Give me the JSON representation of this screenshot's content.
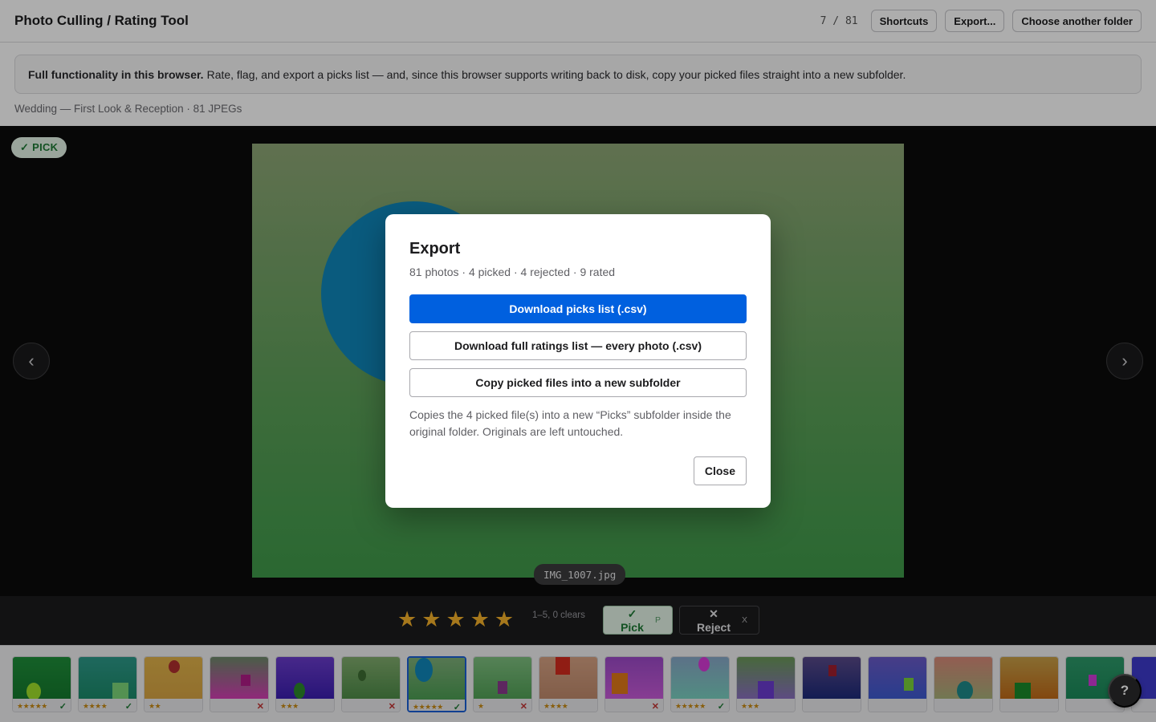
{
  "header": {
    "title": "Photo Culling / Rating Tool",
    "counter": "7 / 81",
    "shortcuts_label": "Shortcuts",
    "export_label": "Export...",
    "choose_folder_label": "Choose another folder"
  },
  "banner": {
    "bold": "Full functionality in this browser.",
    "text": "Rate, flag, and export a picks list — and, since this browser supports writing back to disk, copy your picked files straight into a new subfolder."
  },
  "folder": {
    "subtitle": "Wedding — First Look & Reception · 81 JPEGs"
  },
  "viewer": {
    "pick_badge": "✓ PICK",
    "filename": "IMG_1007.jpg",
    "prev_glyph": "‹",
    "next_glyph": "›"
  },
  "toolbar": {
    "stars": [
      "★",
      "★",
      "★",
      "★",
      "★"
    ],
    "rating": 5,
    "hint": "1–5, 0 clears",
    "pick_label": "✓ Pick",
    "pick_key": "P",
    "reject_label": "✕ Reject",
    "reject_key": "X"
  },
  "filmstrip": [
    {
      "stars": "★★★★★",
      "flag": "pick",
      "bg": "linear-gradient(#1f8f3a,#157a2e)",
      "shape": {
        "type": "ellipse",
        "color": "#9fe02a"
      }
    },
    {
      "stars": "★★★★",
      "flag": "pick",
      "bg": "linear-gradient(#2e9a8a,#1b8a6a)",
      "shape": {
        "type": "rect",
        "color": "#7cd67a"
      }
    },
    {
      "stars": "★★",
      "flag": "",
      "bg": "linear-gradient(#e1b34a,#d8a544)",
      "shape": {
        "type": "ellipse",
        "color": "#b0302e"
      }
    },
    {
      "stars": "",
      "flag": "reject",
      "bg": "linear-gradient(#6d8a6a,#d43db4)",
      "shape": {
        "type": "rect",
        "color": "#b01b86"
      }
    },
    {
      "stars": "★★★",
      "flag": "",
      "bg": "linear-gradient(#6a3ccc,#3b1fb0)",
      "shape": {
        "type": "ellipse",
        "color": "#2c8a2c"
      }
    },
    {
      "stars": "",
      "flag": "reject",
      "bg": "linear-gradient(#82ad6e,#4e8c48)",
      "shape": {
        "type": "ellipse",
        "color": "#3d6e33"
      }
    },
    {
      "stars": "★★★★★",
      "flag": "pick",
      "bg": "linear-gradient(#7fb07a,#4c9e53)",
      "shape": {
        "type": "ellipse",
        "color": "#0f86ba"
      }
    },
    {
      "stars": "★",
      "flag": "reject",
      "bg": "linear-gradient(#7fc080,#52a257)",
      "shape": {
        "type": "rect",
        "color": "#8a3a8c"
      }
    },
    {
      "stars": "★★★★",
      "flag": "",
      "bg": "linear-gradient(#d6a283,#c08a6c)",
      "shape": {
        "type": "rect",
        "color": "#d42b1e"
      }
    },
    {
      "stars": "",
      "flag": "reject",
      "bg": "linear-gradient(#9c4ac8,#c85ad8)",
      "shape": {
        "type": "rect",
        "color": "#e07a18"
      }
    },
    {
      "stars": "★★★★★",
      "flag": "pick",
      "bg": "linear-gradient(#88a8c8,#7ad0c0)",
      "shape": {
        "type": "ellipse",
        "color": "#d73ad8"
      }
    },
    {
      "stars": "★★★",
      "flag": "",
      "bg": "linear-gradient(#6a9a58,#8a70c0)",
      "shape": {
        "type": "rect",
        "color": "#6a3cd0"
      }
    },
    {
      "stars": "",
      "flag": "",
      "bg": "linear-gradient(#5a4a8a,#1c2a7a)",
      "shape": {
        "type": "rect",
        "color": "#a01e2e"
      }
    },
    {
      "stars": "",
      "flag": "",
      "bg": "linear-gradient(#6a5ac8,#3d5ad0)",
      "shape": {
        "type": "rect",
        "color": "#7ad03a"
      }
    },
    {
      "stars": "",
      "flag": "",
      "bg": "linear-gradient(#d88a7a,#a8b07a)",
      "shape": {
        "type": "ellipse",
        "color": "#1e8a8a"
      }
    },
    {
      "stars": "",
      "flag": "",
      "bg": "linear-gradient(#c8a048,#c06a18)",
      "shape": {
        "type": "rect",
        "color": "#1a8a2a"
      }
    },
    {
      "stars": "",
      "flag": "",
      "bg": "linear-gradient(#2e9a6a,#1a8a5a)",
      "shape": {
        "type": "rect",
        "color": "#d03ad8"
      }
    },
    {
      "stars": "",
      "flag": "",
      "bg": "linear-gradient(#3d3acc,#2a2aa8)",
      "shape": {
        "type": "rect",
        "color": "#3d3acc"
      }
    }
  ],
  "current_index": 6,
  "help_label": "?",
  "export_modal": {
    "title": "Export",
    "stats": "81 photos · 4 picked · 4 rejected · 9 rated",
    "download_picks_label": "Download picks list (.csv)",
    "download_full_label": "Download full ratings list — every photo (.csv)",
    "copy_label": "Copy picked files into a new subfolder",
    "note": "Copies the 4 picked file(s) into a new “Picks” subfolder inside the original folder. Originals are left untouched.",
    "close_label": "Close"
  }
}
